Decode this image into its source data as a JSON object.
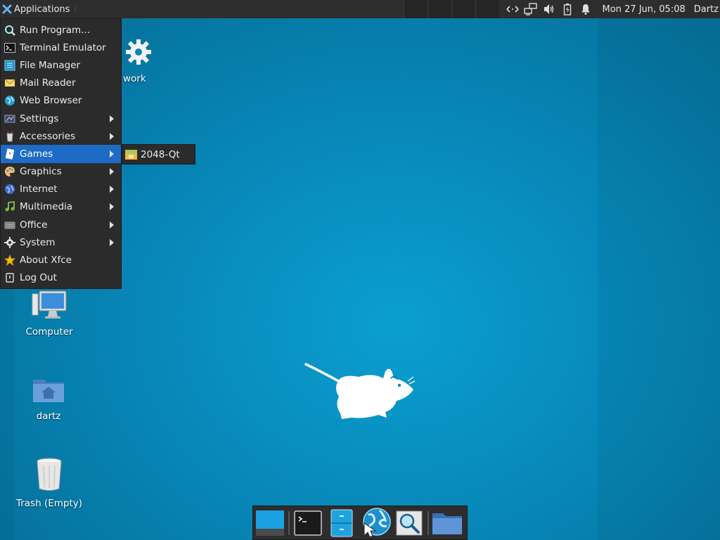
{
  "top_panel": {
    "applications_label": "Applications",
    "clock": "Mon 27 Jun, 05:08",
    "user": "Dartz"
  },
  "menu": {
    "items": [
      {
        "label": "Run Program...",
        "icon": "run-icon",
        "submenu": false
      },
      {
        "label": "Terminal Emulator",
        "icon": "terminal-icon",
        "submenu": false
      },
      {
        "label": "File Manager",
        "icon": "file-manager-icon",
        "submenu": false
      },
      {
        "label": "Mail Reader",
        "icon": "mail-icon",
        "submenu": false
      },
      {
        "label": "Web Browser",
        "icon": "globe-icon",
        "submenu": false
      },
      {
        "label": "Settings",
        "icon": "settings-icon",
        "submenu": true
      },
      {
        "label": "Accessories",
        "icon": "accessories-icon",
        "submenu": true
      },
      {
        "label": "Games",
        "icon": "games-icon",
        "submenu": true,
        "active": true
      },
      {
        "label": "Graphics",
        "icon": "palette-icon",
        "submenu": true
      },
      {
        "label": "Internet",
        "icon": "internet-icon",
        "submenu": true
      },
      {
        "label": "Multimedia",
        "icon": "multimedia-icon",
        "submenu": true
      },
      {
        "label": "Office",
        "icon": "office-icon",
        "submenu": true
      },
      {
        "label": "System",
        "icon": "gear-icon",
        "submenu": true
      },
      {
        "label": "About Xfce",
        "icon": "star-icon",
        "submenu": false
      },
      {
        "label": "Log Out",
        "icon": "logout-icon",
        "submenu": false
      }
    ]
  },
  "games_submenu": {
    "items": [
      {
        "label": "2048-Qt",
        "icon": "game-2048-icon"
      }
    ]
  },
  "desktop": {
    "icons": [
      {
        "label": "work"
      },
      {
        "label": "Computer"
      },
      {
        "label": "dartz"
      },
      {
        "label": "Trash (Empty)"
      }
    ]
  },
  "colors": {
    "panel": "#2d2d2d",
    "menu_bg": "#2b2b2b",
    "highlight": "#1e6bc6",
    "desktop": "#0787b8"
  }
}
